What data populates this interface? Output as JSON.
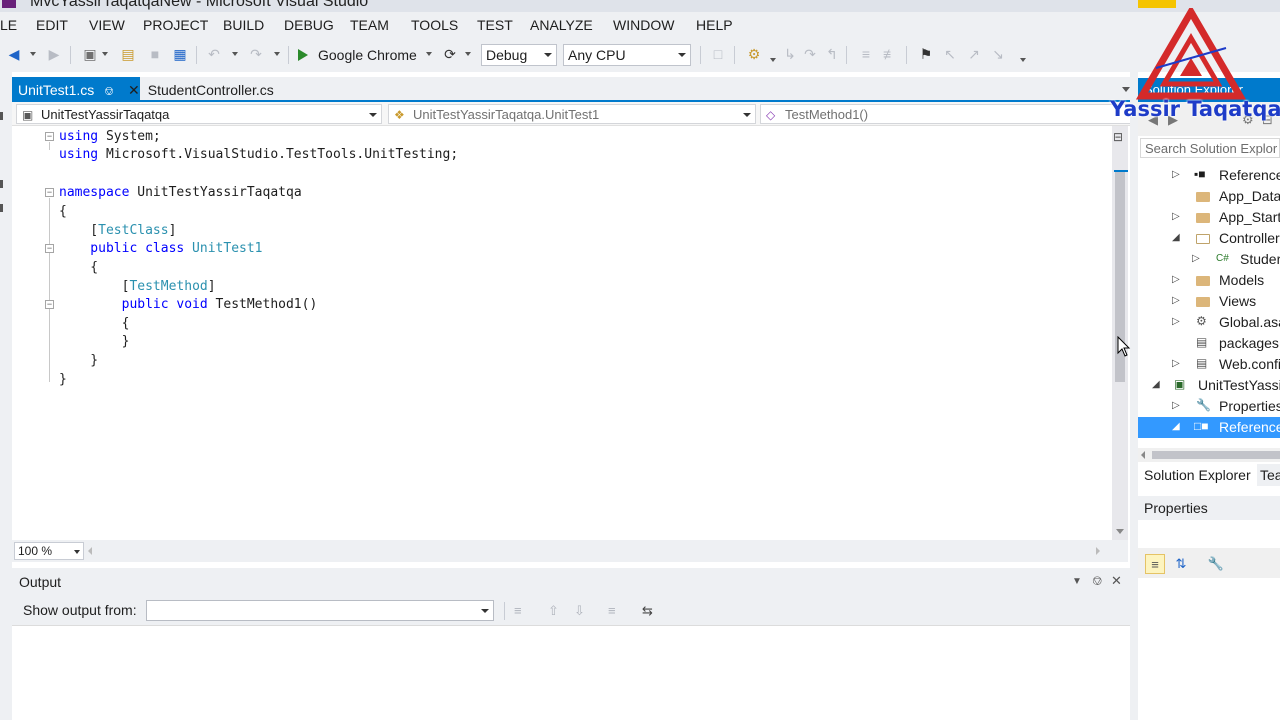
{
  "window": {
    "title": "MvcYassirTaqatqaNew - Microsoft Visual Studio"
  },
  "menu": [
    "LE",
    "EDIT",
    "VIEW",
    "PROJECT",
    "BUILD",
    "DEBUG",
    "TEAM",
    "TOOLS",
    "TEST",
    "ANALYZE",
    "WINDOW",
    "HELP"
  ],
  "toolbar": {
    "run_target": "Google Chrome",
    "configuration": "Debug",
    "platform": "Any CPU"
  },
  "tabs": [
    {
      "label": "UnitTest1.cs",
      "active": true
    },
    {
      "label": "StudentController.cs",
      "active": false
    }
  ],
  "navbar": {
    "project": "UnitTestYassirTaqatqa",
    "type": "UnitTestYassirTaqatqa.UnitTest1",
    "member": "TestMethod1()"
  },
  "code": {
    "l1_kw": "using",
    "l1_rest": " System;",
    "l2_kw": "using",
    "l2_rest": " Microsoft.VisualStudio.TestTools.UnitTesting;",
    "l4_kw": "namespace",
    "l4_rest": " UnitTestYassirTaqatqa",
    "l5": "{",
    "l6_open": "    [",
    "l6_type": "TestClass",
    "l6_close": "]",
    "l7_kw": "    public class",
    "l7_type": " UnitTest1",
    "l8": "    {",
    "l9_open": "        [",
    "l9_type": "TestMethod",
    "l9_close": "]",
    "l10_kw": "        public void",
    "l10_rest": " TestMethod1()",
    "l11": "        {",
    "l12": "        }",
    "l13": "    }",
    "l14": "}"
  },
  "zoom": "100 %",
  "output": {
    "title": "Output",
    "show_from_label": "Show output from:",
    "show_from_value": ""
  },
  "solution_explorer": {
    "header": "Solution Explorer",
    "search_placeholder": "Search Solution Explor",
    "items": [
      {
        "label": "Reference",
        "icon": "references-icon",
        "expander": "collapsed"
      },
      {
        "label": "App_Data",
        "icon": "folder-icon",
        "expander": "none"
      },
      {
        "label": "App_Start",
        "icon": "folder-icon",
        "expander": "collapsed"
      },
      {
        "label": "Controller",
        "icon": "folder-open-icon",
        "expander": "expanded"
      },
      {
        "label": "Studer",
        "icon": "csharp-file-icon",
        "expander": "collapsed"
      },
      {
        "label": "Models",
        "icon": "folder-icon",
        "expander": "collapsed"
      },
      {
        "label": "Views",
        "icon": "folder-icon",
        "expander": "collapsed"
      },
      {
        "label": "Global.asa",
        "icon": "global-asax-icon",
        "expander": "collapsed"
      },
      {
        "label": "packages.",
        "icon": "config-file-icon",
        "expander": "none"
      },
      {
        "label": "Web.confi",
        "icon": "config-file-icon",
        "expander": "collapsed"
      },
      {
        "label": "UnitTestYassi",
        "icon": "test-project-icon",
        "expander": "expanded"
      },
      {
        "label": "Properties",
        "icon": "wrench-icon",
        "expander": "collapsed"
      },
      {
        "label": "Reference",
        "icon": "references-icon",
        "expander": "expanded"
      }
    ],
    "tab_solution": "Solution Explorer",
    "tab_team": "Tea"
  },
  "properties": {
    "header": "Properties"
  },
  "watermark": {
    "text": "Yassir Taqatqa"
  },
  "colors": {
    "accent": "#007acc",
    "keyword": "#0000ff",
    "type": "#2b91af",
    "selection": "#3399ff",
    "watermark_red": "#d42a2a",
    "watermark_blue": "#1e3cc8"
  }
}
